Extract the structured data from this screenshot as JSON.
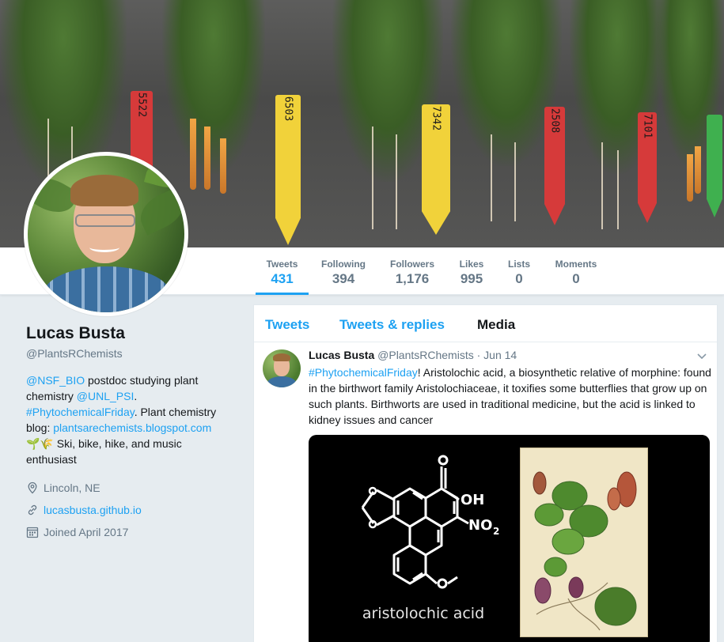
{
  "profile": {
    "name": "Lucas Busta",
    "handle": "@PlantsRChemists",
    "bio": {
      "mention1": "@NSF_BIO",
      "text1": " postdoc studying plant chemistry ",
      "mention2": "@UNL_PSI",
      "text2": ". ",
      "hashtag": "#PhytochemicalFriday",
      "text3": ". Plant chemistry blog: ",
      "blog_link": "plantsarechemists.blogspot.com",
      "emoji": "🌱🌾",
      "text4": " Ski, bike, hike, and music enthusiast"
    },
    "location": "Lincoln, NE",
    "website": "lucasbusta.github.io",
    "joined": "Joined April 2017"
  },
  "stats": [
    {
      "label": "Tweets",
      "value": "431",
      "active": true
    },
    {
      "label": "Following",
      "value": "394"
    },
    {
      "label": "Followers",
      "value": "1,176"
    },
    {
      "label": "Likes",
      "value": "995"
    },
    {
      "label": "Lists",
      "value": "0"
    },
    {
      "label": "Moments",
      "value": "0"
    }
  ],
  "banner_tags": [
    {
      "text": "5522",
      "color": "#d63a3a"
    },
    {
      "text": "6503",
      "color": "#f1d23a"
    },
    {
      "text": "7342",
      "color": "#f1d23a"
    },
    {
      "text": "2508",
      "color": "#d63a3a"
    },
    {
      "text": "7101",
      "color": "#d63a3a"
    },
    {
      "text": "",
      "color": "#3fb04f"
    }
  ],
  "timeline": {
    "tabs": [
      "Tweets",
      "Tweets & replies",
      "Media"
    ],
    "active_tab": "Media",
    "tweet": {
      "name": "Lucas Busta",
      "handle": "@PlantsRChemists",
      "dot": " · ",
      "time": "Jun 14",
      "hashtag": "#PhytochemicalFriday",
      "text": "! Aristolochic acid, a biosynthetic relative of morphine: found in the birthwort family Aristolochiaceae, it toxifies some butterflies that grow up on such plants. Birthworts are used in traditional medicine, but the acid is linked to kidney issues and cancer",
      "media": {
        "oh_label": "OH",
        "no2_label": "NO",
        "no2_sub": "2",
        "caption": "aristolochic acid"
      }
    }
  },
  "colors": {
    "accent": "#1da1f2",
    "muted": "#657786",
    "background": "#e6ecf0"
  }
}
